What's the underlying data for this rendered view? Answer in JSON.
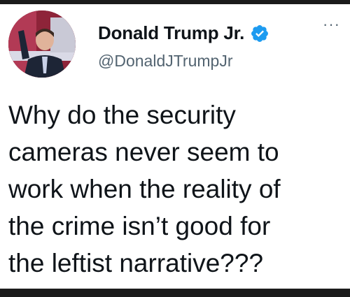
{
  "author": {
    "display_name": "Donald Trump Jr.",
    "handle": "@DonaldJTrumpJr",
    "verified": true,
    "avatar_icon": "profile-photo"
  },
  "menu": {
    "more_label": "···",
    "icon": "more-options-icon"
  },
  "tweet": {
    "lines": [
      "Why do the security",
      "cameras never seem to",
      "work when the reality of",
      "the crime isn’t good for",
      "the leftist narrative???"
    ]
  },
  "colors": {
    "verified_badge": "#1d9bf0",
    "text_primary": "#0f1419",
    "text_secondary": "#536471"
  }
}
